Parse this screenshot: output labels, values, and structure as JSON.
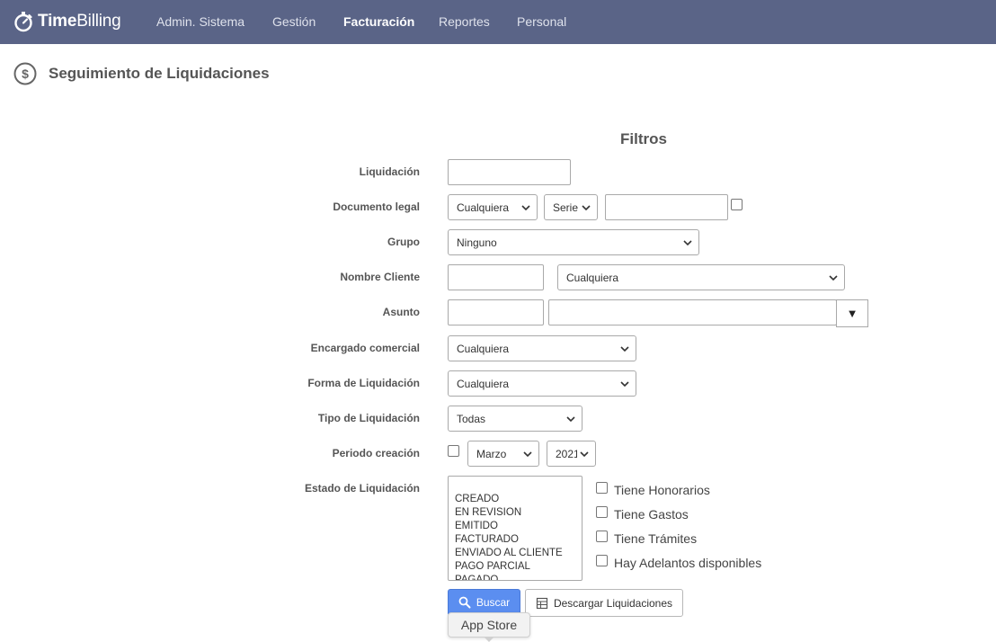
{
  "app": {
    "logo_time": "Time",
    "logo_billing": "Billing"
  },
  "nav": [
    {
      "label": "Admin. Sistema",
      "active": false
    },
    {
      "label": "Gestión",
      "active": false
    },
    {
      "label": "Facturación",
      "active": true
    },
    {
      "label": "Reportes",
      "active": false
    },
    {
      "label": "Personal",
      "active": false
    }
  ],
  "page": {
    "title": "Seguimiento de Liquidaciones"
  },
  "filters": {
    "title": "Filtros",
    "liquidacion": {
      "label": "Liquidación",
      "value": ""
    },
    "documento_legal": {
      "label": "Documento legal",
      "tipo": "Cualquiera",
      "serie": "Serie",
      "numero": ""
    },
    "grupo": {
      "label": "Grupo",
      "value": "Ninguno"
    },
    "nombre_cliente": {
      "label": "Nombre Cliente",
      "codigo": "",
      "value": "Cualquiera"
    },
    "asunto": {
      "label": "Asunto",
      "codigo": "",
      "value": "",
      "dropdown_glyph": "▼"
    },
    "encargado_comercial": {
      "label": "Encargado comercial",
      "value": "Cualquiera"
    },
    "forma_liquidacion": {
      "label": "Forma de Liquidación",
      "value": "Cualquiera"
    },
    "tipo_liquidacion": {
      "label": "Tipo de Liquidación",
      "value": "Todas"
    },
    "periodo_creacion": {
      "label": "Periodo creación",
      "mes": "Marzo",
      "anio": "2021"
    },
    "estado_liquidacion": {
      "label": "Estado de Liquidación",
      "options": [
        "CREADO",
        "EN REVISION",
        "EMITIDO",
        "FACTURADO",
        "ENVIADO AL CLIENTE",
        "PAGO PARCIAL",
        "PAGADO"
      ]
    },
    "checks": {
      "honorarios": "Tiene Honorarios",
      "gastos": "Tiene Gastos",
      "tramites": "Tiene Trámites",
      "adelantos": "Hay Adelantos disponibles"
    }
  },
  "buttons": {
    "buscar": "Buscar",
    "descargar": "Descargar Liquidaciones"
  },
  "tooltip": {
    "text": "App Store"
  },
  "colors": {
    "nav_bg": "#5a6487",
    "primary_button": "#5b8ef0"
  }
}
